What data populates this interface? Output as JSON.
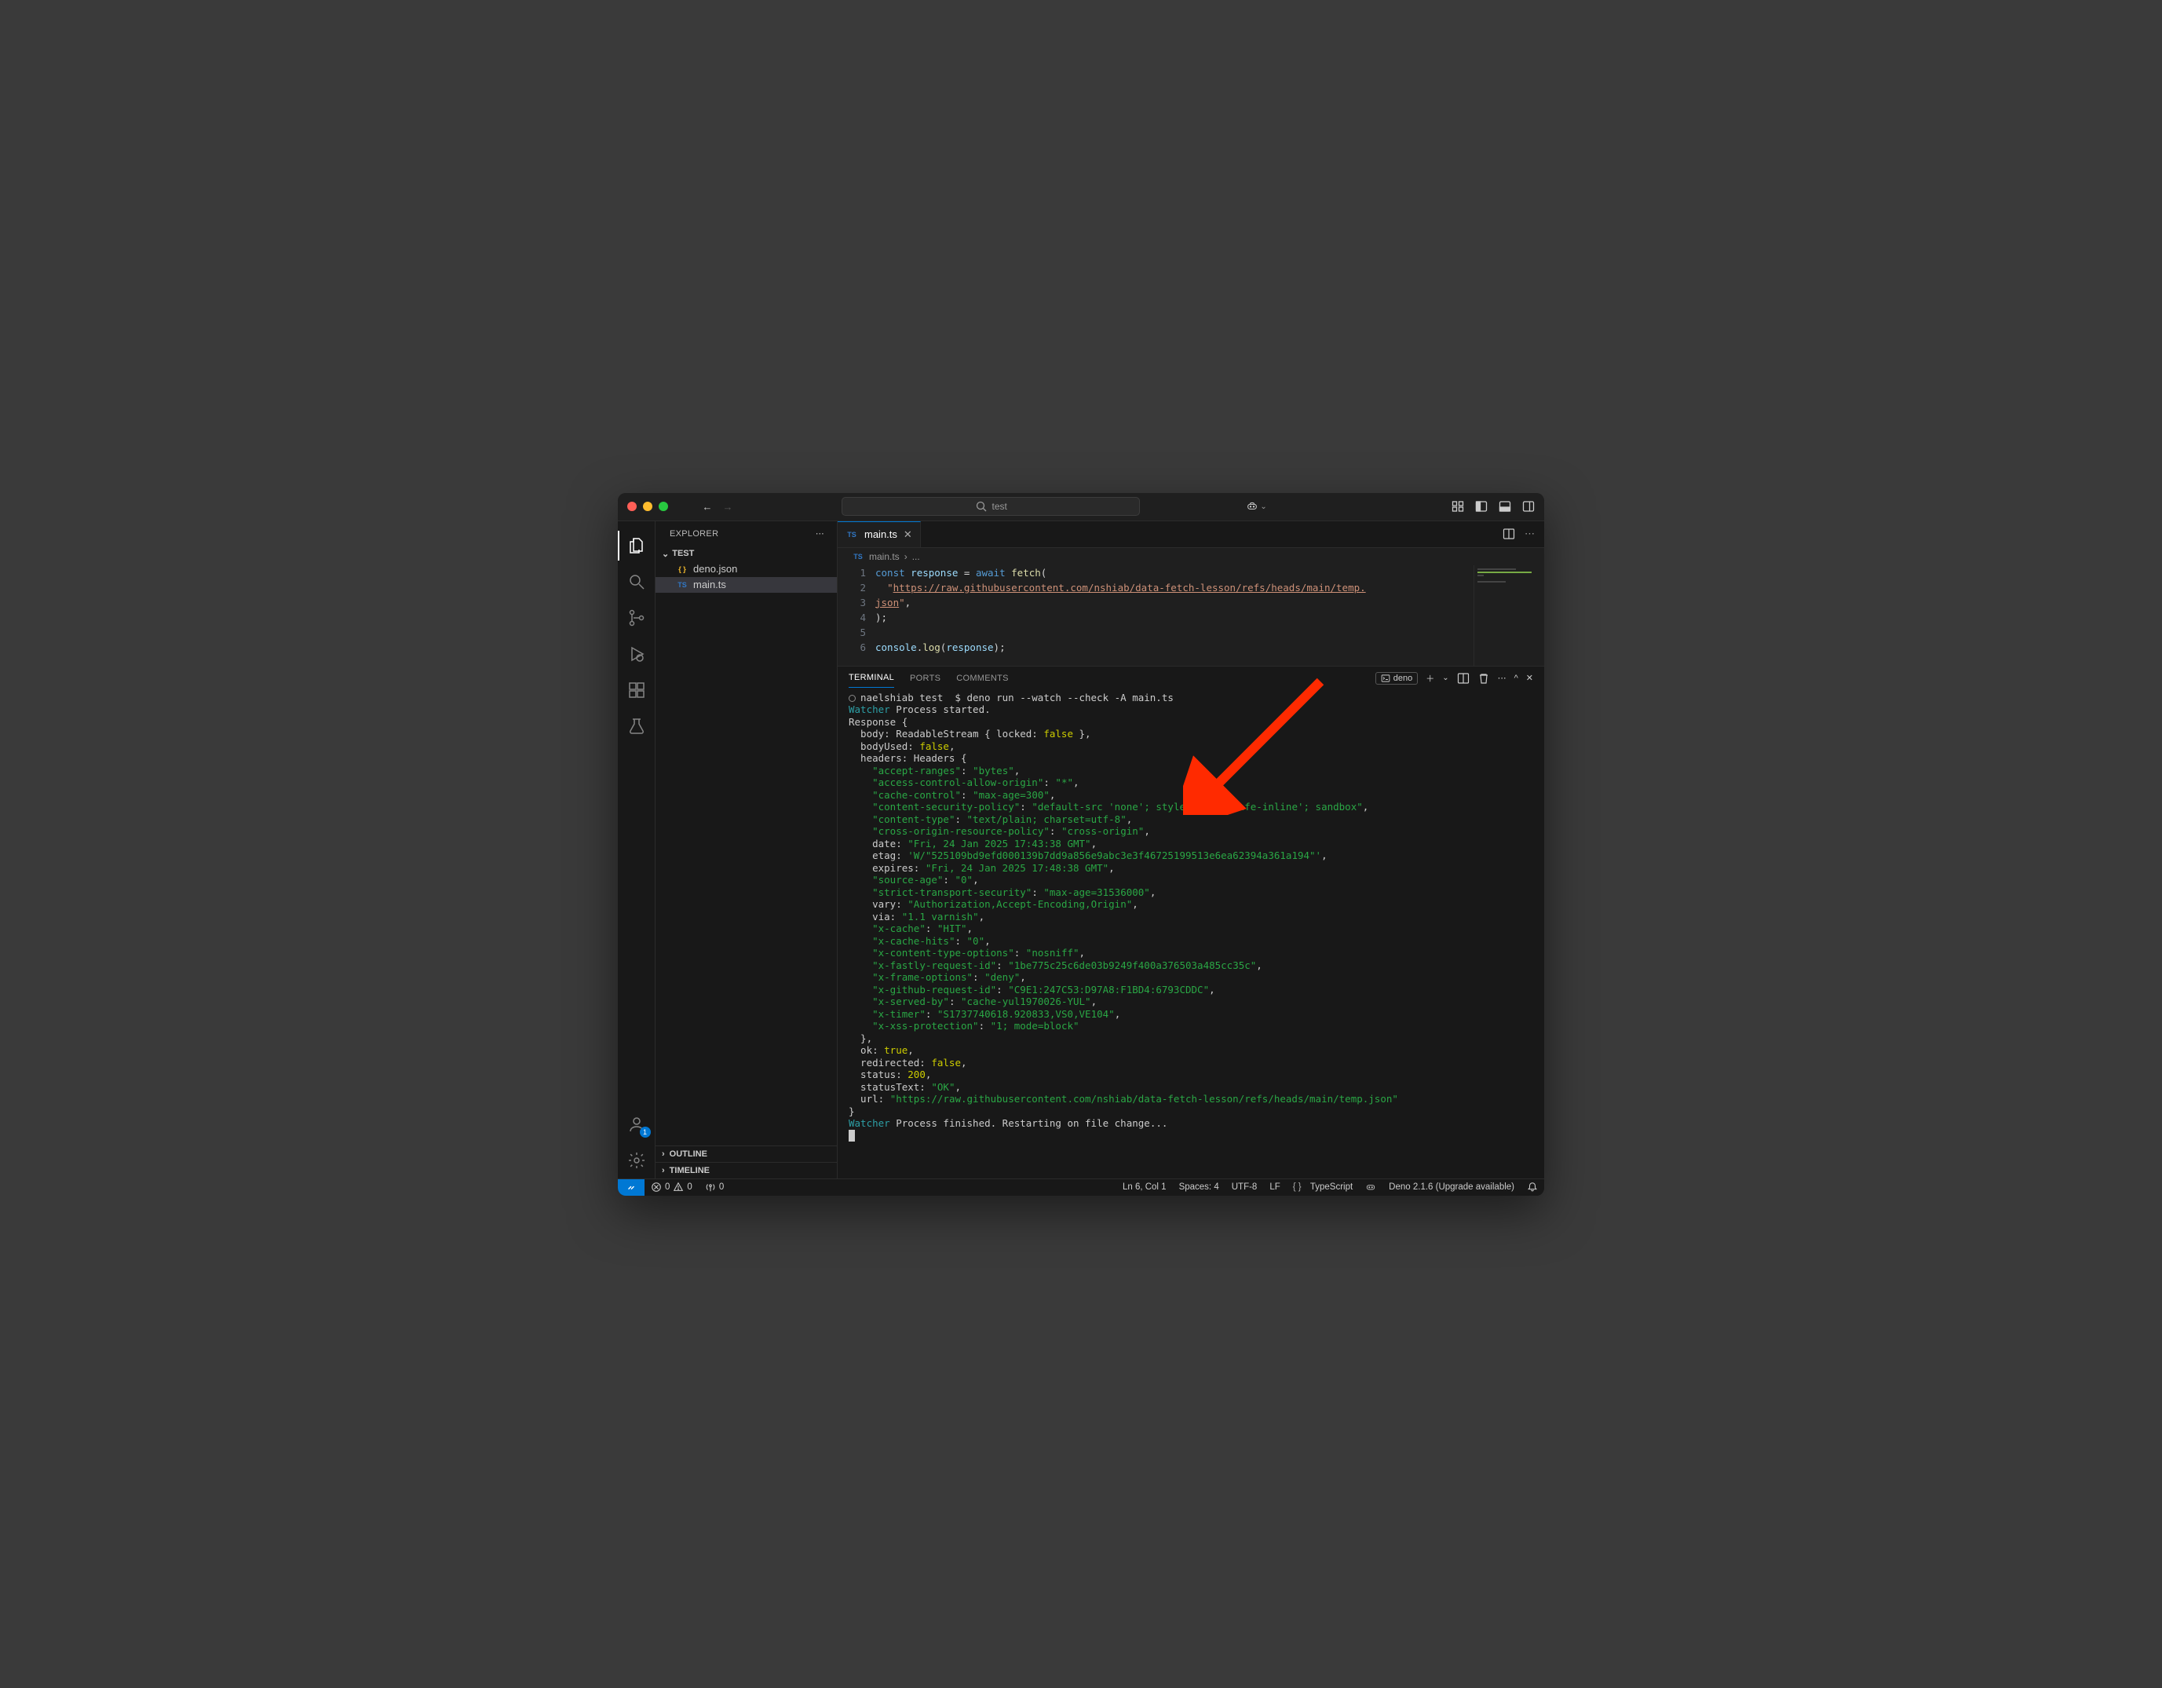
{
  "titlebar": {
    "search_placeholder": "test"
  },
  "sidebar": {
    "header": "EXPLORER",
    "folder": "TEST",
    "files": [
      {
        "icon": "{ }",
        "name": "deno.json"
      },
      {
        "icon": "TS",
        "name": "main.ts"
      }
    ],
    "outline": "OUTLINE",
    "timeline": "TIMELINE"
  },
  "tab": {
    "icon": "TS",
    "label": "main.ts"
  },
  "breadcrumb": {
    "icon": "TS",
    "file": "main.ts",
    "sep": "›",
    "tail": "..."
  },
  "editor": {
    "line_numbers": [
      "1",
      "2",
      "3",
      "4",
      "5",
      "6"
    ],
    "l1_kw_const": "const",
    "l1_var_response": "response",
    "l1_eq": " = ",
    "l1_kw_await": "await",
    "l1_fn_fetch": "fetch",
    "l1_open": "(",
    "l2_indent": "  ",
    "l2_q1": "\"",
    "l2_url_a": "https://raw.githubusercontent.com/nshiab/data-fetch-lesson/refs/heads/main/temp.",
    "l2_url_b": "json",
    "l2_q2": "\"",
    "l2_comma": ",",
    "l3": ");",
    "l5_obj": "console",
    "l5_dot": ".",
    "l5_fn": "log",
    "l5_open": "(",
    "l5_arg": "response",
    "l5_close": ");"
  },
  "panel": {
    "tabs": {
      "t1": "TERMINAL",
      "t2": "PORTS",
      "t3": "COMMENTS"
    },
    "shell_label": "deno"
  },
  "terminal": {
    "prompt_user": "naelshiab",
    "prompt_folder": "test",
    "prompt_dollar": "  $ ",
    "cmd": "deno run --watch --check -A main.ts",
    "watcher_label": "Watcher",
    "watcher_started": " Process started.",
    "resp_open": "Response {",
    "body_line_a": "  body: ReadableStream { locked: ",
    "body_line_b": "false",
    "body_line_c": " },",
    "bodyUsed_a": "  bodyUsed: ",
    "bodyUsed_b": "false",
    "bodyUsed_c": ",",
    "headers_open": "  headers: Headers {",
    "headers": [
      {
        "k": "accept-ranges",
        "v": "bytes"
      },
      {
        "k": "access-control-allow-origin",
        "v": "*"
      },
      {
        "k": "cache-control",
        "v": "max-age=300"
      },
      {
        "k": "content-security-policy",
        "v": "default-src 'none'; style-src 'unsafe-inline'; sandbox"
      },
      {
        "k": "content-type",
        "v": "text/plain; charset=utf-8"
      },
      {
        "k": "cross-origin-resource-policy",
        "v": "cross-origin"
      }
    ],
    "date_a": "    date: ",
    "date_b": "Fri, 24 Jan 2025 17:43:38 GMT",
    "etag_a": "    etag: ",
    "etag_b": "W/\"525109bd9efd000139b7dd9a856e9abc3e3f46725199513e6ea62394a361a194\"",
    "expires_a": "    expires: ",
    "expires_b": "Fri, 24 Jan 2025 17:48:38 GMT",
    "headers2": [
      {
        "k": "source-age",
        "v": "0"
      },
      {
        "k": "strict-transport-security",
        "v": "max-age=31536000"
      }
    ],
    "vary_a": "    vary: ",
    "vary_b": "Authorization,Accept-Encoding,Origin",
    "via_a": "    via: ",
    "via_b": "1.1 varnish",
    "headers3": [
      {
        "k": "x-cache",
        "v": "HIT"
      },
      {
        "k": "x-cache-hits",
        "v": "0"
      },
      {
        "k": "x-content-type-options",
        "v": "nosniff"
      },
      {
        "k": "x-fastly-request-id",
        "v": "1be775c25c6de03b9249f400a376503a485cc35c"
      },
      {
        "k": "x-frame-options",
        "v": "deny"
      },
      {
        "k": "x-github-request-id",
        "v": "C9E1:247C53:D97A8:F1BD4:6793CDDC"
      },
      {
        "k": "x-served-by",
        "v": "cache-yul1970026-YUL"
      },
      {
        "k": "x-timer",
        "v": "S1737740618.920833,VS0,VE104"
      },
      {
        "k": "x-xss-protection",
        "v": "1; mode=block"
      }
    ],
    "headers_close": "  },",
    "ok_a": "  ok: ",
    "ok_b": "true",
    "redirected_a": "  redirected: ",
    "redirected_b": "false",
    "status_a": "  status: ",
    "status_b": "200",
    "statusText_a": "  statusText: ",
    "statusText_b": "OK",
    "url_a": "  url: ",
    "url_b": "https://raw.githubusercontent.com/nshiab/data-fetch-lesson/refs/heads/main/temp.json",
    "resp_close": "}",
    "watcher_finished": " Process finished. Restarting on file change..."
  },
  "statusbar": {
    "errors": "0",
    "warnings": "0",
    "port": "0",
    "ln_col": "Ln 6, Col 1",
    "spaces": "Spaces: 4",
    "encoding": "UTF-8",
    "eol": "LF",
    "lang_icon": "{ }",
    "lang": "TypeScript",
    "deno": "Deno 2.1.6 (Upgrade available)"
  },
  "accounts_badge": "1"
}
